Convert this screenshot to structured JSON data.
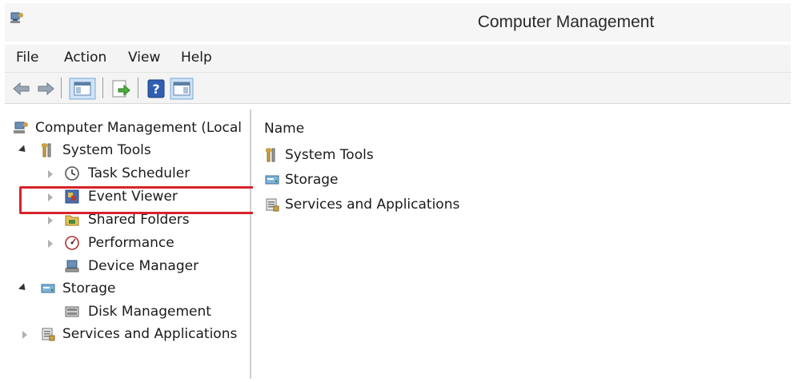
{
  "window": {
    "title": "Computer Management"
  },
  "menu": {
    "items": [
      "File",
      "Action",
      "View",
      "Help"
    ]
  },
  "toolbar": {
    "buttons": [
      "back-arrow-icon",
      "forward-arrow-icon",
      "show-hide-console-tree-icon",
      "export-list-icon",
      "help-icon",
      "show-hide-action-pane-icon"
    ]
  },
  "tree": {
    "root": "Computer Management (Local",
    "system_tools": "System Tools",
    "task_scheduler": "Task Scheduler",
    "event_viewer": "Event Viewer",
    "shared_folders": "Shared Folders",
    "performance": "Performance",
    "device_manager": "Device Manager",
    "storage": "Storage",
    "disk_management": "Disk Management",
    "services_apps": "Services and Applications"
  },
  "list": {
    "column_name": "Name",
    "items": [
      "System Tools",
      "Storage",
      "Services and Applications"
    ]
  },
  "colors": {
    "highlight": "#d8232a",
    "toolbar_bg": "#f4f4f4"
  }
}
